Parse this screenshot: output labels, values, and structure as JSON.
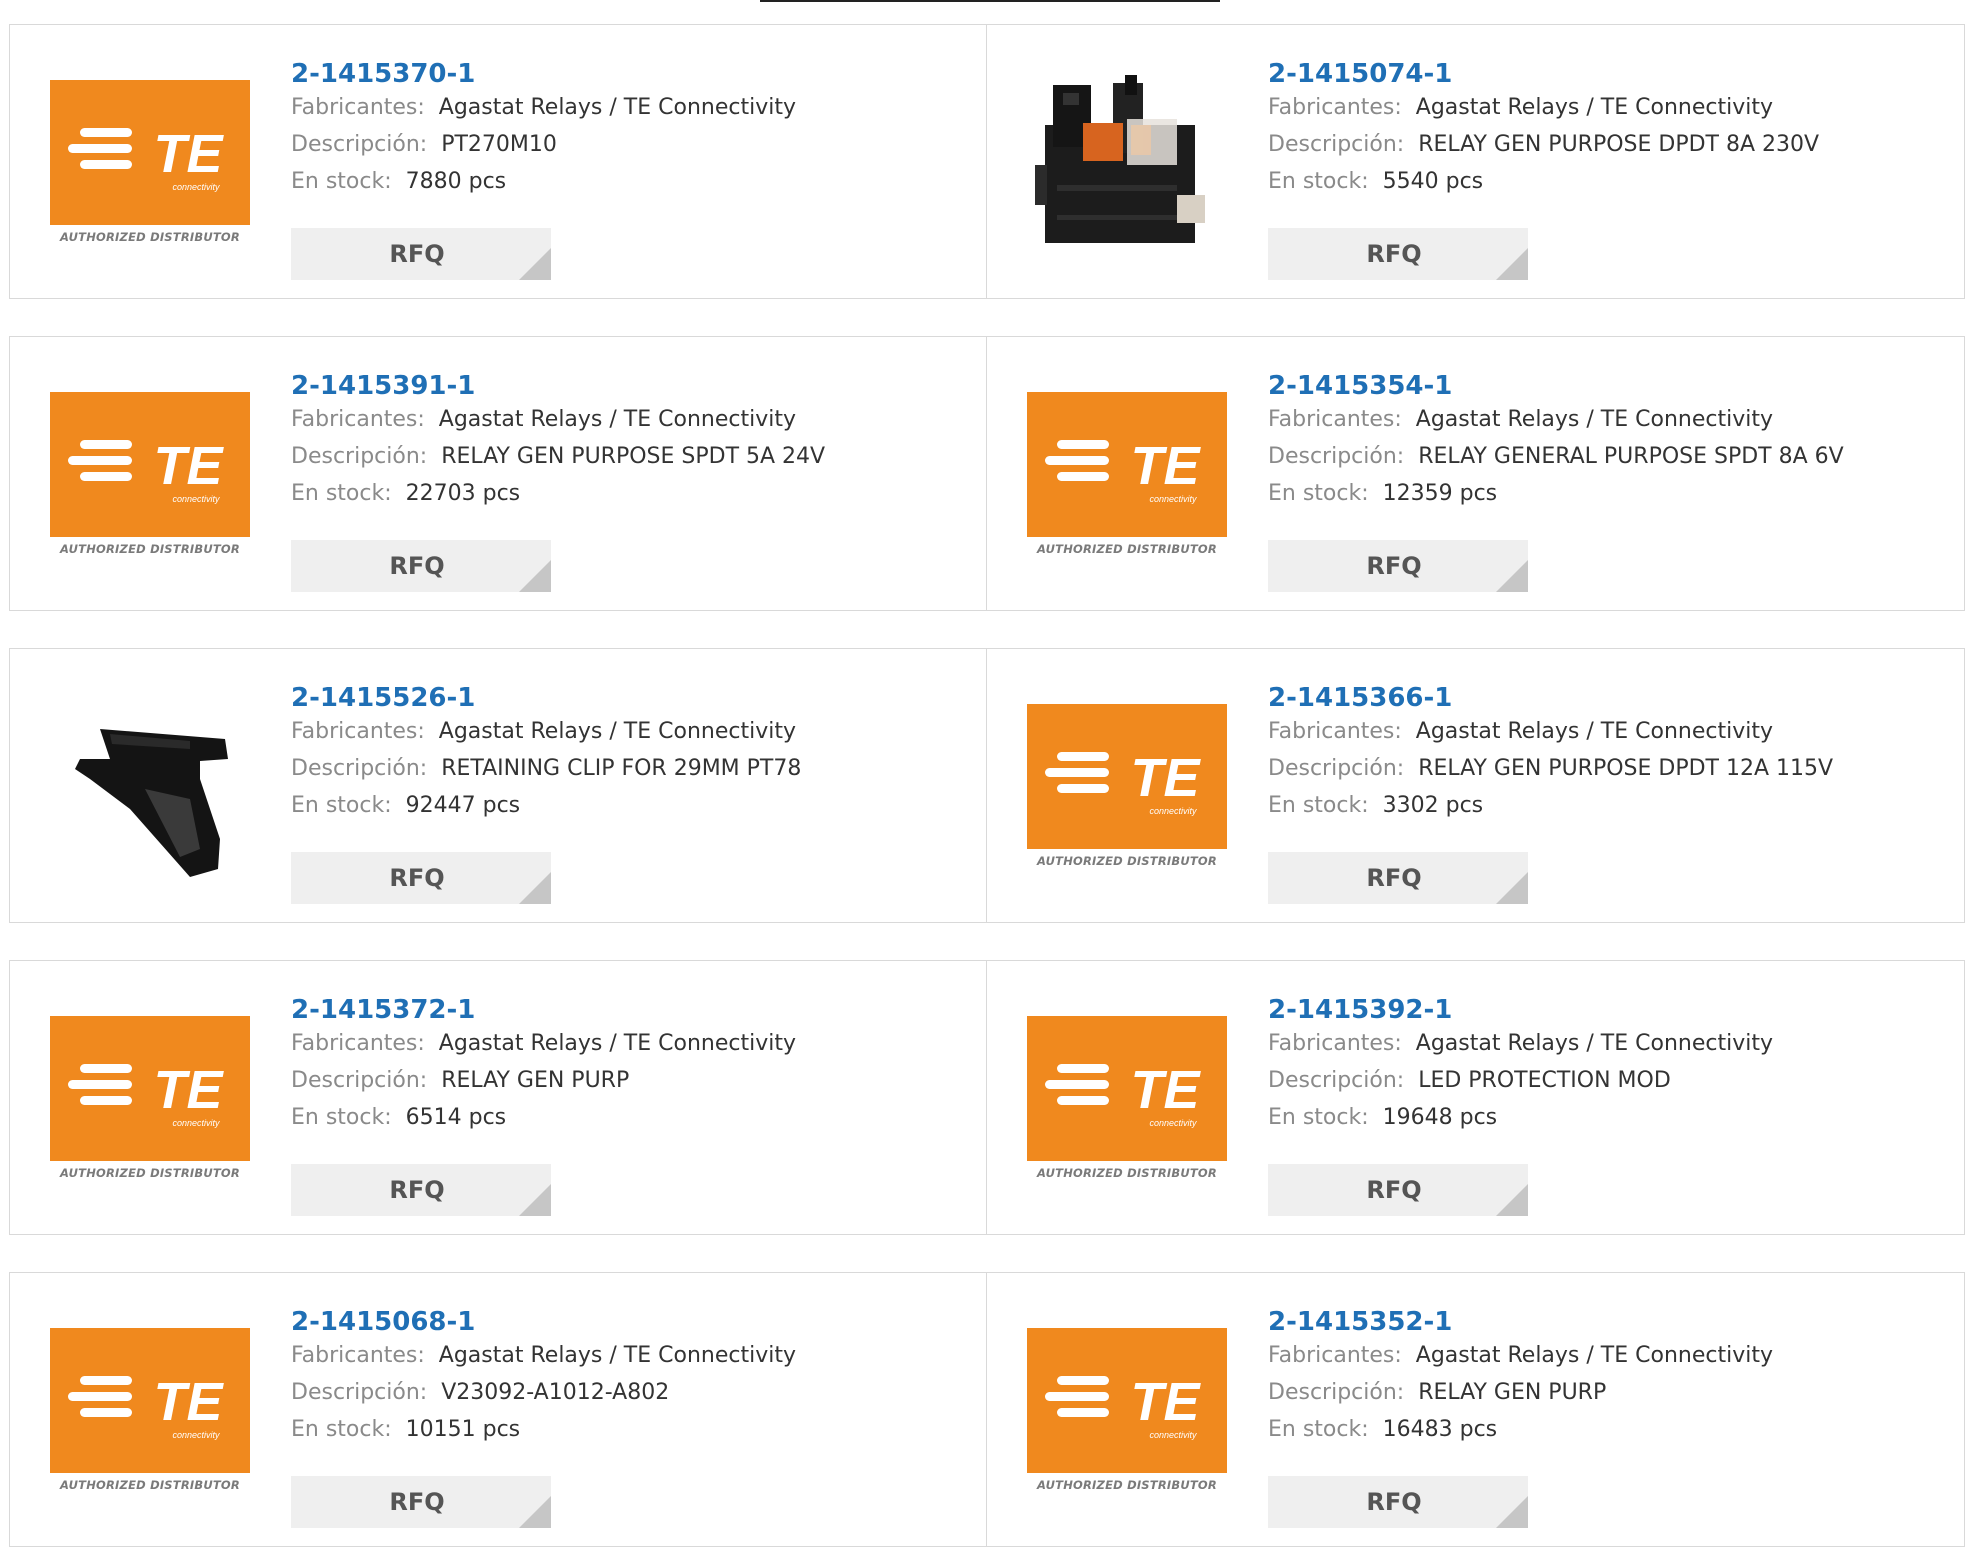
{
  "labels": {
    "manufacturer": "Fabricantes:",
    "description": "Descripción:",
    "stock": "En stock:",
    "rfq": "RFQ",
    "logo_text": "TE",
    "logo_sub": "connectivity",
    "logo_caption": "AUTHORIZED DISTRIBUTOR"
  },
  "colors": {
    "accent": "#1f6fb5",
    "brand_orange": "#f0891e"
  },
  "products": [
    {
      "part": "2-1415370-1",
      "manufacturer": "Agastat Relays / TE Connectivity",
      "description": "PT270M10",
      "stock": "7880 pcs",
      "image": "te-logo"
    },
    {
      "part": "2-1415074-1",
      "manufacturer": "Agastat Relays / TE Connectivity",
      "description": "RELAY GEN PURPOSE DPDT 8A 230V",
      "stock": "5540 pcs",
      "image": "relay-socket-photo"
    },
    {
      "part": "2-1415391-1",
      "manufacturer": "Agastat Relays / TE Connectivity",
      "description": "RELAY GEN PURPOSE SPDT 5A 24V",
      "stock": "22703 pcs",
      "image": "te-logo"
    },
    {
      "part": "2-1415354-1",
      "manufacturer": "Agastat Relays / TE Connectivity",
      "description": "RELAY GENERAL PURPOSE SPDT 8A 6V",
      "stock": "12359 pcs",
      "image": "te-logo"
    },
    {
      "part": "2-1415526-1",
      "manufacturer": "Agastat Relays / TE Connectivity",
      "description": "RETAINING CLIP FOR 29MM PT78",
      "stock": "92447 pcs",
      "image": "retaining-clip-photo"
    },
    {
      "part": "2-1415366-1",
      "manufacturer": "Agastat Relays / TE Connectivity",
      "description": "RELAY GEN PURPOSE DPDT 12A 115V",
      "stock": "3302 pcs",
      "image": "te-logo"
    },
    {
      "part": "2-1415372-1",
      "manufacturer": "Agastat Relays / TE Connectivity",
      "description": "RELAY GEN PURP",
      "stock": "6514 pcs",
      "image": "te-logo"
    },
    {
      "part": "2-1415392-1",
      "manufacturer": "Agastat Relays / TE Connectivity",
      "description": "LED PROTECTION MOD",
      "stock": "19648 pcs",
      "image": "te-logo"
    },
    {
      "part": "2-1415068-1",
      "manufacturer": "Agastat Relays / TE Connectivity",
      "description": "V23092-A1012-A802",
      "stock": "10151 pcs",
      "image": "te-logo"
    },
    {
      "part": "2-1415352-1",
      "manufacturer": "Agastat Relays / TE Connectivity",
      "description": "RELAY GEN PURP",
      "stock": "16483 pcs",
      "image": "te-logo"
    }
  ]
}
